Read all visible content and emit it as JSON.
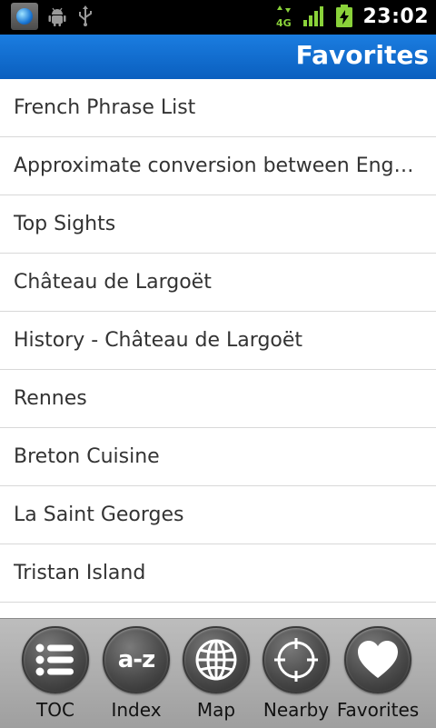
{
  "status_bar": {
    "time": "23:02",
    "network_type": "4G",
    "icons": [
      "app-orb-icon",
      "android-debug-icon",
      "usb-icon",
      "network-4g-icon",
      "signal-icon",
      "battery-charging-icon"
    ]
  },
  "title_bar": {
    "title": "Favorites"
  },
  "favorites": {
    "items": [
      "French Phrase List",
      "Approximate conversion between English and French",
      "Top Sights",
      "Château de Largoët",
      "History - Château de Largoët",
      "Rennes",
      "Breton Cuisine",
      "La Saint Georges",
      "Tristan Island"
    ]
  },
  "toolbar": {
    "toc": "TOC",
    "index": "Index",
    "index_icon_text": "a-z",
    "map": "Map",
    "nearby": "Nearby",
    "favorites": "Favorites"
  },
  "colors": {
    "title_bar": "#0a6fd3",
    "status_bar": "#000000",
    "toolbar": "#adadad",
    "item_text": "#333333",
    "divider": "#d8d8d8"
  }
}
